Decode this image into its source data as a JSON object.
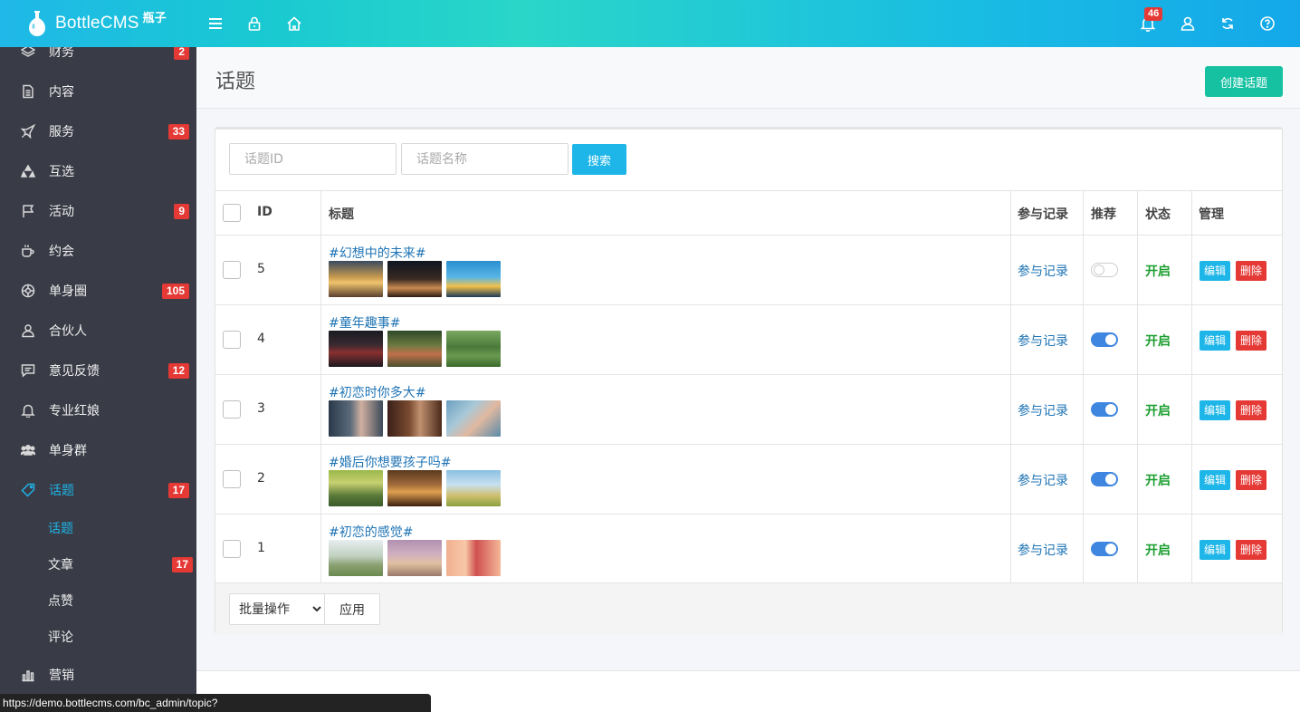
{
  "brand": {
    "name": "BottleCMS",
    "sub": "瓶子"
  },
  "header": {
    "notification_count": "46"
  },
  "sidebar": {
    "items": [
      {
        "label": "财务",
        "badge": "2",
        "icon": "layers-icon"
      },
      {
        "label": "内容",
        "badge": "",
        "icon": "document-icon"
      },
      {
        "label": "服务",
        "badge": "33",
        "icon": "rocket-icon"
      },
      {
        "label": "互选",
        "badge": "",
        "icon": "recycle-icon"
      },
      {
        "label": "活动",
        "badge": "9",
        "icon": "flag-icon"
      },
      {
        "label": "约会",
        "badge": "",
        "icon": "coffee-icon"
      },
      {
        "label": "单身圈",
        "badge": "105",
        "icon": "globe-icon"
      },
      {
        "label": "合伙人",
        "badge": "",
        "icon": "user-icon"
      },
      {
        "label": "意见反馈",
        "badge": "12",
        "icon": "comment-icon"
      },
      {
        "label": "专业红娘",
        "badge": "",
        "icon": "bell-icon"
      },
      {
        "label": "单身群",
        "badge": "",
        "icon": "users-icon"
      },
      {
        "label": "话题",
        "badge": "17",
        "icon": "tag-icon"
      }
    ],
    "subitems": [
      {
        "label": "话题",
        "badge": ""
      },
      {
        "label": "文章",
        "badge": "17"
      },
      {
        "label": "点赞",
        "badge": ""
      },
      {
        "label": "评论",
        "badge": ""
      }
    ],
    "bottom_item": {
      "label": "营销",
      "icon": "bar-chart-icon"
    }
  },
  "page": {
    "title": "话题",
    "create_label": "创建话题"
  },
  "search": {
    "id_placeholder": "话题ID",
    "name_placeholder": "话题名称",
    "button_label": "搜索"
  },
  "table": {
    "headers": {
      "id": "ID",
      "title": "标题",
      "records": "参与记录",
      "recommend": "推荐",
      "status": "状态",
      "manage": "管理"
    },
    "rows": [
      {
        "id": "5",
        "title": "#幻想中的未来#",
        "records": "参与记录",
        "recommended": false,
        "status": "开启",
        "edit": "编辑",
        "delete": "删除"
      },
      {
        "id": "4",
        "title": "#童年趣事#",
        "records": "参与记录",
        "recommended": true,
        "status": "开启",
        "edit": "编辑",
        "delete": "删除"
      },
      {
        "id": "3",
        "title": "#初恋时你多大#",
        "records": "参与记录",
        "recommended": true,
        "status": "开启",
        "edit": "编辑",
        "delete": "删除"
      },
      {
        "id": "2",
        "title": "#婚后你想要孩子吗#",
        "records": "参与记录",
        "recommended": true,
        "status": "开启",
        "edit": "编辑",
        "delete": "删除"
      },
      {
        "id": "1",
        "title": "#初恋的感觉#",
        "records": "参与记录",
        "recommended": true,
        "status": "开启",
        "edit": "编辑",
        "delete": "删除"
      }
    ]
  },
  "bulk": {
    "select_value": "批量操作",
    "apply_label": "应用"
  },
  "statusbar": {
    "url": "https://demo.bottlecms.com/bc_admin/topic?"
  }
}
